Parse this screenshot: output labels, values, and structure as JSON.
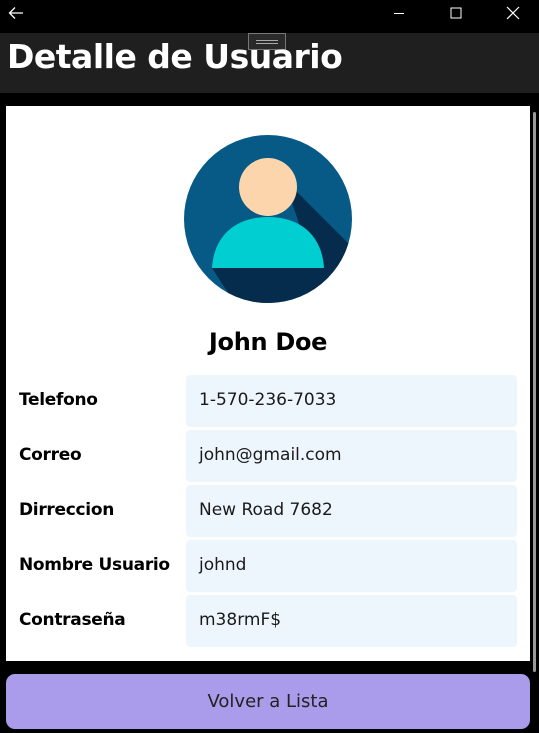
{
  "window": {
    "back_icon": "arrow-left-icon",
    "minimize_icon": "minimize-icon",
    "maximize_icon": "maximize-icon",
    "close_icon": "close-icon"
  },
  "header": {
    "title": "Detalle de Usuario"
  },
  "profile": {
    "avatar_icon": "user-avatar-icon",
    "name": "John Doe",
    "fields": [
      {
        "label": "Telefono",
        "value": "1-570-236-7033"
      },
      {
        "label": "Correo",
        "value": "john@gmail.com"
      },
      {
        "label": "Dirreccion",
        "value": "New Road 7682"
      },
      {
        "label": "Nombre Usuario",
        "value": "johnd"
      },
      {
        "label": "Contraseña",
        "value": "m38rmF$"
      }
    ]
  },
  "actions": {
    "back_to_list_label": "Volver a Lista"
  },
  "colors": {
    "background": "#000000",
    "header": "#1f1f1f",
    "card": "#ffffff",
    "field_background": "#eef6fd",
    "button": "#ab9ceb",
    "avatar_circle": "#075a86",
    "avatar_shadow": "#062c4d",
    "avatar_head": "#fcd5ac",
    "avatar_body": "#00ced1"
  }
}
